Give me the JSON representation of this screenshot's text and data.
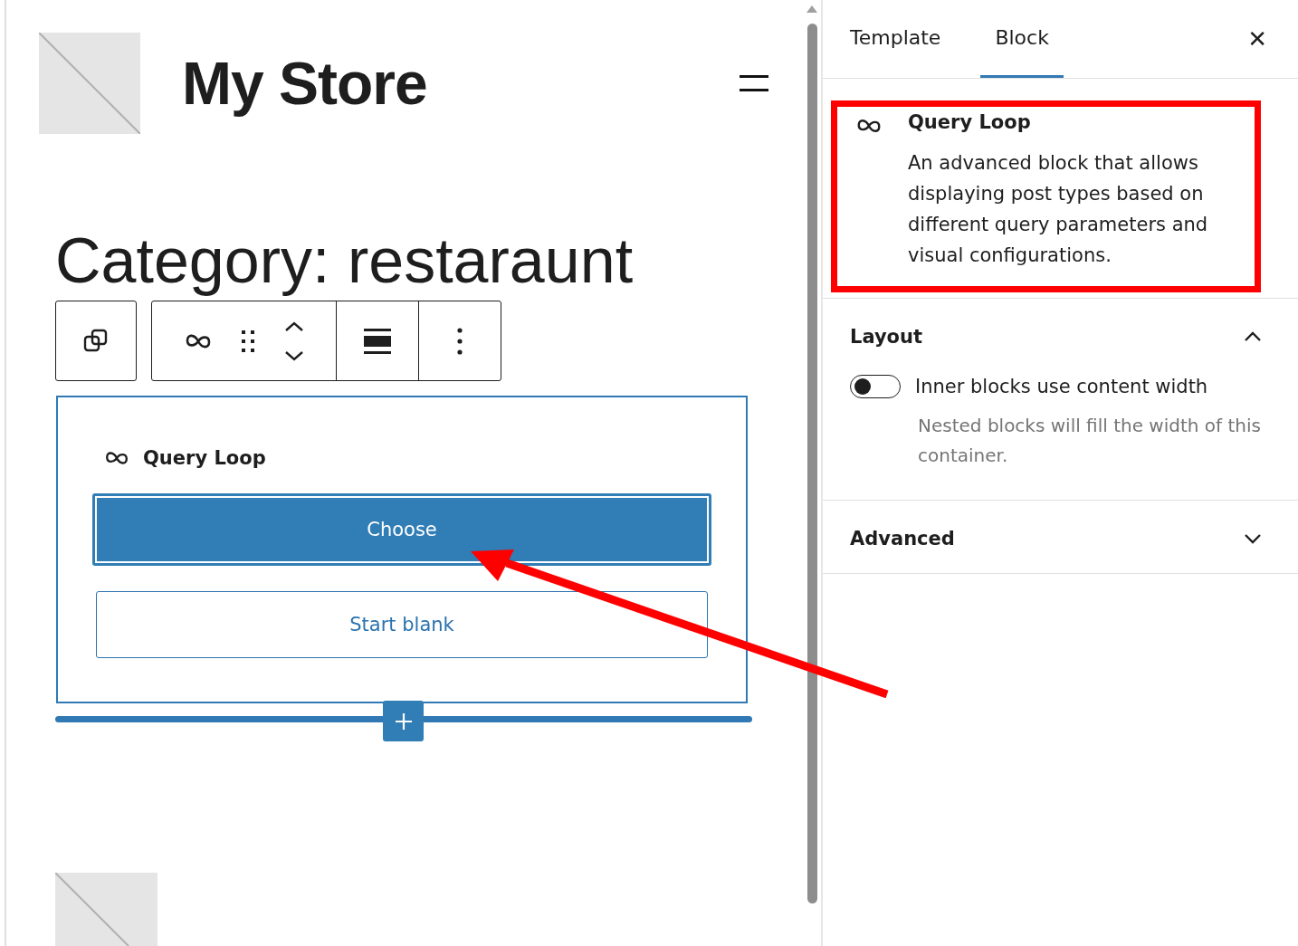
{
  "canvas": {
    "site_title": "My Store",
    "heading": "Category: restaraunt",
    "block": {
      "label": "Query Loop",
      "buttons": [
        {
          "label": "Choose",
          "kind": "primary"
        },
        {
          "label": "Start blank",
          "kind": "secondary"
        }
      ]
    }
  },
  "sidebar": {
    "tabs": [
      {
        "label": "Template",
        "selected": false
      },
      {
        "label": "Block",
        "selected": true
      }
    ],
    "close": "✕",
    "block_card": {
      "title": "Query Loop",
      "description": "An advanced block that allows displaying post types based on different query parameters and visual configurations."
    },
    "panels": [
      {
        "title": "Layout",
        "expanded": true,
        "toggle": {
          "label": "Inner blocks use content width",
          "on": false,
          "help": "Nested blocks will fill the width of this container."
        }
      },
      {
        "title": "Advanced",
        "expanded": false
      }
    ]
  }
}
